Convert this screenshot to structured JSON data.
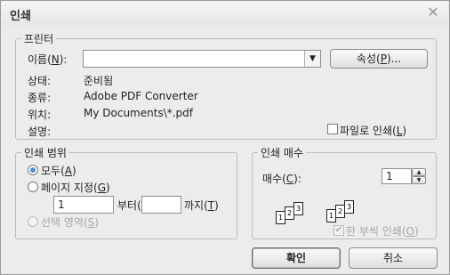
{
  "dialog": {
    "title": "인쇄",
    "close_glyph": "✕"
  },
  "printer": {
    "legend": "프린터",
    "name_label": "이름(N):",
    "name_value": "",
    "dropdown_glyph": "▼",
    "properties_button": "속성(P)...",
    "status_label": "상태:",
    "status_value": "준비됨",
    "type_label": "종류:",
    "type_value": "Adobe PDF Converter",
    "where_label": "위치:",
    "where_value": "My Documents\\*.pdf",
    "comment_label": "설명:",
    "print_to_file": "파일로 인쇄(L)",
    "print_to_file_checked": false
  },
  "range": {
    "legend": "인쇄 범위",
    "all": "모두(A)",
    "pages": "페이지 지정(G)",
    "from_value": "1",
    "from_label": "부터(F)",
    "to_value": "",
    "to_label": "까지(T)",
    "selection": "선택 영역(S)",
    "selected": "all"
  },
  "copies": {
    "legend": "인쇄 매수",
    "count_label": "매수(C):",
    "count_value": "1",
    "collate_label": "한 부씩 인쇄(O)",
    "collate_checked": true,
    "page_numbers": [
      "1",
      "2",
      "3"
    ]
  },
  "actions": {
    "ok": "확인",
    "cancel": "취소"
  }
}
